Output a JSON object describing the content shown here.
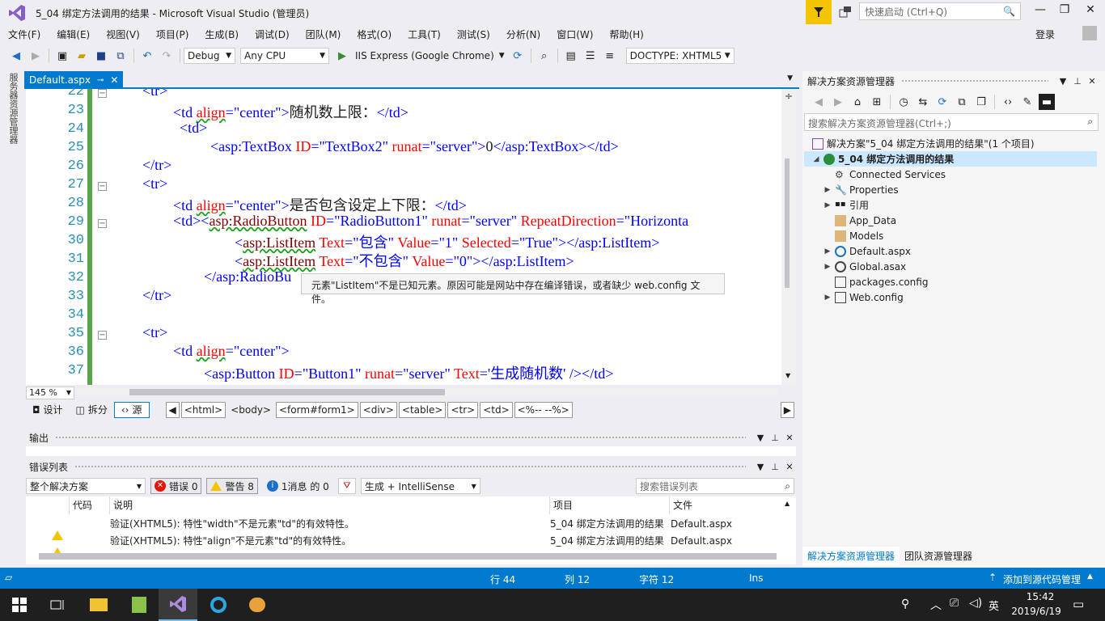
{
  "window": {
    "title": "5_04 绑定方法调用的结果 - Microsoft Visual Studio (管理员)",
    "quick_launch_placeholder": "快速启动 (Ctrl+Q)",
    "login": "登录",
    "controls": {
      "minimize": "—",
      "maximize": "❐",
      "close": "✕"
    }
  },
  "menu": [
    "文件(F)",
    "编辑(E)",
    "视图(V)",
    "项目(P)",
    "生成(B)",
    "调试(D)",
    "团队(M)",
    "格式(O)",
    "工具(T)",
    "测试(S)",
    "分析(N)",
    "窗口(W)",
    "帮助(H)"
  ],
  "toolbar": {
    "config": "Debug",
    "platform": "Any CPU",
    "run_target": "IIS Express (Google Chrome)",
    "doctype": "DOCTYPE: XHTML5"
  },
  "side_tab": "服务器资源管理器",
  "editor": {
    "tab_label": "Default.aspx",
    "lines": [
      {
        "n": "22",
        "fold": true
      },
      {
        "n": "23"
      },
      {
        "n": "24"
      },
      {
        "n": "25"
      },
      {
        "n": "26"
      },
      {
        "n": "27",
        "fold": true
      },
      {
        "n": "28"
      },
      {
        "n": "29",
        "fold": true
      },
      {
        "n": "30"
      },
      {
        "n": "31"
      },
      {
        "n": "32"
      },
      {
        "n": "33"
      },
      {
        "n": "34"
      },
      {
        "n": "35",
        "fold": true
      },
      {
        "n": "36"
      },
      {
        "n": "37"
      }
    ],
    "code": {
      "l22": "<tr>",
      "l23_a": "<td ",
      "l23_attr": "align",
      "l23_eq": "=",
      "l23_val": "\"center\"",
      "l23_close": ">",
      "l23_text": "随机数上限：",
      "l23_end": "</td>",
      "l24": "<td>",
      "l25_open": "<asp:TextBox ",
      "l25_id": "ID",
      "l25_idv": "\"TextBox2\"",
      "l25_rn": "runat",
      "l25_rnv": "\"server\"",
      "l25_close": ">",
      "l25_text": "0",
      "l25_end": "</asp:TextBox></td>",
      "l26": "</tr>",
      "l27": "<tr>",
      "l28_a": "<td ",
      "l28_attr": "align",
      "l28_eq": "=",
      "l28_val": "\"center\"",
      "l28_close": ">",
      "l28_text": "是否包含设定上下限：",
      "l28_end": "</td>",
      "l29_open": "<td><",
      "l29_tag": "asp:RadioButton",
      "l29_id": "ID",
      "l29_idv": "\"RadioButton1\"",
      "l29_rn": "runat",
      "l29_rnv": "\"server\"",
      "l29_rd": "RepeatDirection",
      "l29_rdv": "\"Horizonta",
      "l30_open": "<",
      "l30_tag": "asp:ListItem",
      "l30_t": "Text",
      "l30_tv": "\"包含\"",
      "l30_v": "Value",
      "l30_vv": "\"1\"",
      "l30_s": "Selected",
      "l30_sv": "\"True\"",
      "l30_end": "></asp:ListItem>",
      "l31_open": "<",
      "l31_tag": "asp:ListItem",
      "l31_t": "Text",
      "l31_tv": "\"不包含\"",
      "l31_v": "Value",
      "l31_vv": "\"0\"",
      "l31_end": "></asp:ListItem>",
      "l32": "</asp:RadioBu",
      "l33": "</tr>",
      "l35": "<tr>",
      "l36_a": "<td ",
      "l36_attr": "align",
      "l36_eq": "=",
      "l36_val": "\"center\"",
      "l36_close": ">",
      "l37_open": "<asp:Button ",
      "l37_id": "ID",
      "l37_idv": "\"Button1\"",
      "l37_rn": "runat",
      "l37_rnv": "\"server\"",
      "l37_t": "Text",
      "l37_tv": "'生成随机数'",
      "l37_end": " /></td>"
    },
    "tooltip": "元素\"ListItem\"不是已知元素。原因可能是网站中存在编译错误，或者缺少 web.config 文件。",
    "zoom": "145 %",
    "views": {
      "design": "设计",
      "split": "拆分",
      "source": "源"
    },
    "breadcrumbs": [
      "<html>",
      "<body>",
      "<form#form1>",
      "<div>",
      "<table>",
      "<tr>",
      "<td>",
      "<%-- --%>"
    ]
  },
  "output": {
    "title": "输出"
  },
  "error_list": {
    "title": "错误列表",
    "scope": "整个解决方案",
    "errors": "错误 0",
    "warnings": "警告 8",
    "messages": "1消息 的 0",
    "build_filter": "生成 + IntelliSense",
    "search_placeholder": "搜索错误列表",
    "columns": {
      "code": "代码",
      "desc": "说明",
      "project": "项目",
      "file": "文件"
    },
    "rows": [
      {
        "desc": "验证(XHTML5): 特性\"width\"不是元素\"td\"的有效特性。",
        "project": "5_04 绑定方法调用的结果",
        "file": "Default.aspx"
      },
      {
        "desc": "验证(XHTML5): 特性\"align\"不是元素\"td\"的有效特性。",
        "project": "5_04 绑定方法调用的结果",
        "file": "Default.aspx"
      }
    ]
  },
  "solution_explorer": {
    "title": "解决方案资源管理器",
    "search_placeholder": "搜索解决方案资源管理器(Ctrl+;)",
    "solution": "解决方案\"5_04 绑定方法调用的结果\"(1 个项目)",
    "project": "5_04 绑定方法调用的结果",
    "items": [
      {
        "label": "Connected Services",
        "expand": ""
      },
      {
        "label": "Properties",
        "expand": "▶"
      },
      {
        "label": "引用",
        "expand": "▶"
      },
      {
        "label": "App_Data",
        "expand": ""
      },
      {
        "label": "Models",
        "expand": ""
      },
      {
        "label": "Default.aspx",
        "expand": "▶"
      },
      {
        "label": "Global.asax",
        "expand": "▶"
      },
      {
        "label": "packages.config",
        "expand": ""
      },
      {
        "label": "Web.config",
        "expand": "▶"
      }
    ],
    "bottom_tabs": [
      "解决方案资源管理器",
      "团队资源管理器"
    ]
  },
  "status": {
    "line": "行 44",
    "col": "列 12",
    "ch": "字符 12",
    "mode": "Ins",
    "source_control": "添加到源代码管理"
  },
  "taskbar": {
    "ime": "英",
    "time": "15:42",
    "date": "2019/6/19"
  }
}
